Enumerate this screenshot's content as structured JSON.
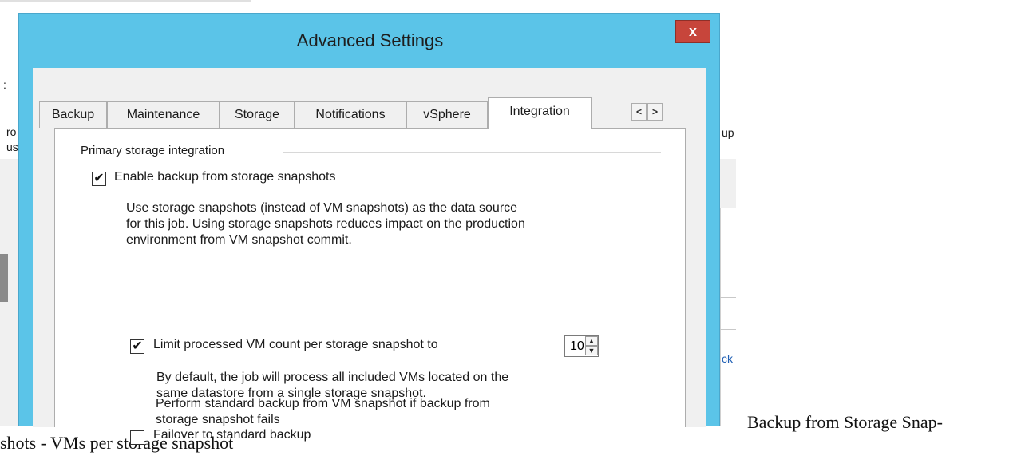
{
  "background": {
    "fragments": [
      "ro",
      "us",
      "up",
      "ck",
      ":"
    ]
  },
  "dialog": {
    "title": "Advanced Settings",
    "close_label": "x",
    "tabs": [
      {
        "label": "Backup",
        "active": false
      },
      {
        "label": "Maintenance",
        "active": false
      },
      {
        "label": "Storage",
        "active": false
      },
      {
        "label": "Notifications",
        "active": false
      },
      {
        "label": "vSphere",
        "active": false
      },
      {
        "label": "Integration",
        "active": true
      }
    ],
    "tab_scroll": {
      "left": "<",
      "right": ">"
    },
    "group_label": "Primary storage integration",
    "enable_backup": {
      "checked": true,
      "label": "Enable backup from storage snapshots",
      "description": [
        "Use storage snapshots (instead of VM snapshots) as the data source",
        "for this job. Using storage snapshots reduces impact on the production",
        "environment from VM snapshot commit."
      ]
    },
    "limit_vm": {
      "checked": true,
      "label": "Limit processed VM count per storage snapshot to",
      "value": "10",
      "description": [
        "By default, the job will process all included VMs located on the",
        "same datastore from a single storage snapshot."
      ]
    },
    "failover": {
      "checked": false,
      "label": "Failover to standard backup",
      "description": [
        "Perform standard backup from VM snapshot if backup from",
        "storage snapshot fails"
      ]
    }
  },
  "caption": {
    "line1": "Backup from Storage Snap-",
    "line2": "shots - VMs per storage snapshot"
  },
  "colors": {
    "title_bar": "#5bc4e8",
    "close_button": "#c7453b",
    "link": "#1f5fb4"
  }
}
